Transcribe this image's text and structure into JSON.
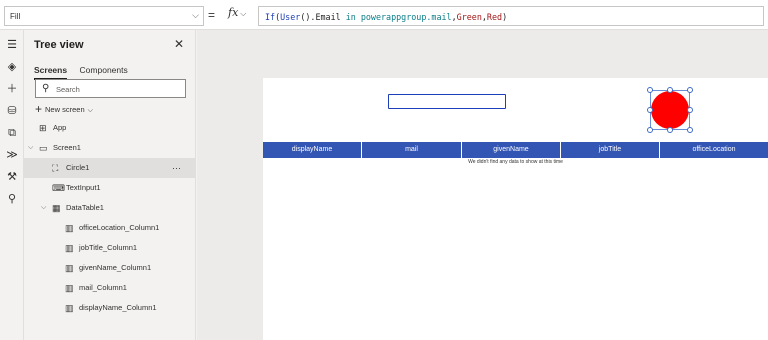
{
  "formula_bar": {
    "property": "Fill",
    "equals": "=",
    "fx": "fx",
    "formula_tokens": [
      {
        "text": "If",
        "kind": "fn"
      },
      {
        "text": "(",
        "kind": "txt"
      },
      {
        "text": "User",
        "kind": "fn"
      },
      {
        "text": "().Email ",
        "kind": "txt"
      },
      {
        "text": "in",
        "kind": "kw"
      },
      {
        "text": " powerappgroup.mail",
        "kind": "id"
      },
      {
        "text": ",",
        "kind": "txt"
      },
      {
        "text": "Green",
        "kind": "val"
      },
      {
        "text": ",",
        "kind": "txt"
      },
      {
        "text": "Red",
        "kind": "val"
      },
      {
        "text": ")",
        "kind": "txt"
      }
    ]
  },
  "rail": {
    "icons": [
      "menu-icon",
      "layers-icon",
      "insert-icon",
      "data-icon",
      "media-icon",
      "power-automate-icon",
      "advanced-tools-icon",
      "search-icon"
    ]
  },
  "tree": {
    "title": "Tree view",
    "tabs": [
      "Screens",
      "Components"
    ],
    "search_placeholder": "Search",
    "new_screen": "New screen",
    "items": [
      {
        "label": "App",
        "indent": 0,
        "caret": "",
        "icon": "app-icon",
        "glyph": "⊞",
        "selected": false
      },
      {
        "label": "Screen1",
        "indent": 0,
        "caret": "⌵",
        "icon": "screen-icon",
        "glyph": "▭",
        "selected": false
      },
      {
        "label": "Circle1",
        "indent": 1,
        "caret": "",
        "icon": "circle-shape-icon",
        "glyph": "⛶",
        "selected": true
      },
      {
        "label": "TextInput1",
        "indent": 1,
        "caret": "",
        "icon": "text-input-icon",
        "glyph": "⌨",
        "selected": false
      },
      {
        "label": "DataTable1",
        "indent": 1,
        "caret": "⌵",
        "icon": "data-table-icon",
        "glyph": "▦",
        "selected": false
      },
      {
        "label": "officeLocation_Column1",
        "indent": 2,
        "caret": "",
        "icon": "column-icon",
        "glyph": "▥",
        "selected": false
      },
      {
        "label": "jobTitle_Column1",
        "indent": 2,
        "caret": "",
        "icon": "column-icon",
        "glyph": "▥",
        "selected": false
      },
      {
        "label": "givenName_Column1",
        "indent": 2,
        "caret": "",
        "icon": "column-icon",
        "glyph": "▥",
        "selected": false
      },
      {
        "label": "mail_Column1",
        "indent": 2,
        "caret": "",
        "icon": "column-icon",
        "glyph": "▥",
        "selected": false
      },
      {
        "label": "displayName_Column1",
        "indent": 2,
        "caret": "",
        "icon": "column-icon",
        "glyph": "▥",
        "selected": false
      }
    ],
    "more": "···"
  },
  "canvas": {
    "circle_color": "#ff0000",
    "table_header_color": "#3355b3",
    "columns": [
      "displayName",
      "mail",
      "givenName",
      "jobTitle",
      "officeLocation"
    ],
    "empty_message": "We didn't find any data to show at this time"
  }
}
